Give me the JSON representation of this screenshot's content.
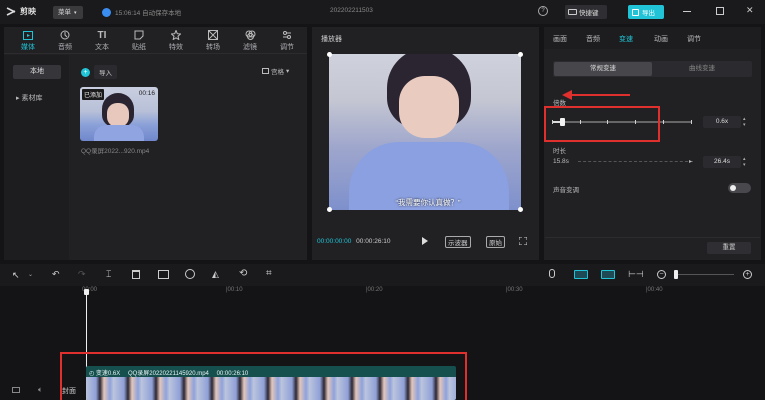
{
  "app": {
    "logo_text": "剪映",
    "menu_label": "菜单",
    "autosave_status": "15:06:14 自动保存本地",
    "project_title": "20220221150​3",
    "shortcut_label": "快捷键",
    "export_label": "导出"
  },
  "toolbar_tabs": [
    {
      "label": "媒体",
      "icon": "media-icon"
    },
    {
      "label": "音频",
      "icon": "audio-icon"
    },
    {
      "label": "文本",
      "icon": "text-icon"
    },
    {
      "label": "贴纸",
      "icon": "sticker-icon"
    },
    {
      "label": "特效",
      "icon": "effects-icon"
    },
    {
      "label": "转场",
      "icon": "transition-icon"
    },
    {
      "label": "滤镜",
      "icon": "filter-icon"
    },
    {
      "label": "调节",
      "icon": "adjust-icon"
    }
  ],
  "media": {
    "nav_local": "本地",
    "nav_library": "素材库",
    "import_label": "导入",
    "view_label": "宫格",
    "clip": {
      "badge": "已添加",
      "duration": "00:16",
      "filename": "QQ录屏2022...920.mp4"
    }
  },
  "player": {
    "title": "播放器",
    "subtitle": "“我需要你认真做？”",
    "current_time": "00:00:00:00",
    "total_time": "00:00:26:10",
    "oscilloscope_label": "示波器",
    "ratio_label": "原始"
  },
  "inspector": {
    "tabs": [
      "画面",
      "音频",
      "变速",
      "动画",
      "调节"
    ],
    "active_tab": "变速",
    "speed_mode_normal": "常规变速",
    "speed_mode_curve": "曲线变速",
    "multiplier_label": "倍数",
    "multiplier_value": "0.6x",
    "multiplier_level": 0.06,
    "duration_label": "时长",
    "duration_from": "15.8s",
    "duration_to": "26.4s",
    "pitch_label": "声音变调",
    "pitch_enabled": false,
    "reset_label": "重置"
  },
  "timeline": {
    "ruler": [
      "00:00",
      "|00:10",
      "|00:20",
      "|00:30",
      "|00:40"
    ],
    "cover_label": "封面",
    "clip_speed": "变速0.6X",
    "clip_name": "QQ录屏20220221145920.mp4",
    "clip_duration": "00:00:26:10"
  },
  "colors": {
    "accent": "#20c4d6",
    "annotation_red": "#e0302e",
    "panel": "#212124",
    "background": "#141416"
  }
}
